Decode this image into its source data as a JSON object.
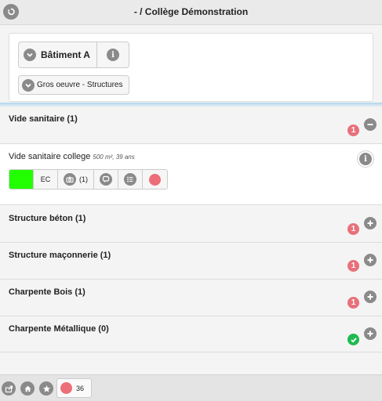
{
  "header": {
    "title": "- / Collège Démonstration",
    "back_icon": "back-arrow-icon"
  },
  "filters": {
    "building_label": "Bâtiment A",
    "building_info_icon": "info-icon",
    "trade_label": "Gros oeuvre - Structures"
  },
  "sections": [
    {
      "title": "Vide sanitaire (1)",
      "badge": "1",
      "status": "alert",
      "toggle": "collapse"
    },
    {
      "title": "Structure béton (1)",
      "badge": "1",
      "status": "alert",
      "toggle": "expand"
    },
    {
      "title": "Structure maçonnerie (1)",
      "badge": "1",
      "status": "alert",
      "toggle": "expand"
    },
    {
      "title": "Charpente Bois (1)",
      "badge": "1",
      "status": "alert",
      "toggle": "expand"
    },
    {
      "title": "Charpente Métallique (0)",
      "badge": "",
      "status": "ok",
      "toggle": "expand"
    }
  ],
  "item": {
    "title": "Vide sanitaire college",
    "meta": "500 m², 39 ans",
    "toolbar": {
      "state_color": "#22ff00",
      "code": "EC",
      "photo_count": "(1)",
      "icons": [
        "camera-icon",
        "comment-icon",
        "list-icon"
      ],
      "status_color": "#ec6e78"
    }
  },
  "footer": {
    "icons": [
      "share-icon",
      "home-icon",
      "star-icon"
    ],
    "alert_count": "36",
    "alert_color": "#ec6e78"
  },
  "colors": {
    "alert_badge": "#e8707a",
    "ok_badge": "#1fba4f",
    "icon_grey": "#8a8a8a"
  }
}
